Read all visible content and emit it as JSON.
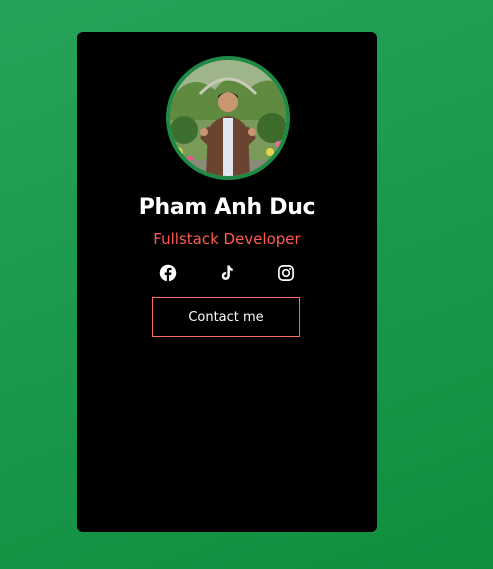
{
  "profile": {
    "name": "Pham Anh Duc",
    "role": "Fullstack Developer",
    "avatar_icon": "profile-photo"
  },
  "socials": [
    {
      "icon": "facebook-icon"
    },
    {
      "icon": "tiktok-icon"
    },
    {
      "icon": "instagram-icon"
    }
  ],
  "actions": {
    "contact_label": "Contact me"
  },
  "colors": {
    "background": "#1f9b50",
    "card": "#000000",
    "accent": "#ff5a4e",
    "avatar_ring": "#1f8a46",
    "text": "#ffffff"
  }
}
